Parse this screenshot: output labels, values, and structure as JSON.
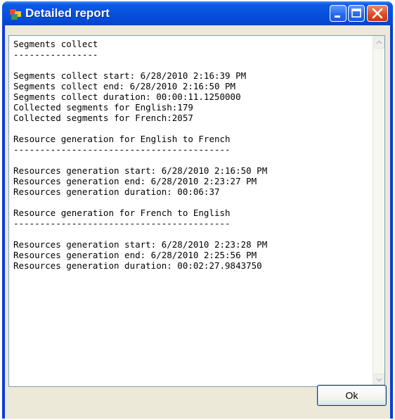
{
  "window": {
    "title": "Detailed report",
    "icons": {
      "app": "window-app-icon",
      "minimize": "minimize-icon",
      "maximize": "maximize-icon",
      "close": "close-icon"
    }
  },
  "report": {
    "lines": [
      "Segments collect",
      "----------------",
      "",
      "Segments collect start: 6/28/2010 2:16:39 PM",
      "Segments collect end: 6/28/2010 2:16:50 PM",
      "Segments collect duration: 00:00:11.1250000",
      "Collected segments for English:179",
      "Collected segments for French:2057",
      "",
      "Resource generation for English to French",
      "-----------------------------------------",
      "",
      "Resources generation start: 6/28/2010 2:16:50 PM",
      "Resources generation end: 6/28/2010 2:23:27 PM",
      "Resources generation duration: 00:06:37",
      "",
      "Resource generation for French to English",
      "-----------------------------------------",
      "",
      "Resources generation start: 6/28/2010 2:23:28 PM",
      "Resources generation end: 6/28/2010 2:25:56 PM",
      "Resources generation duration: 00:02:27.9843750"
    ]
  },
  "buttons": {
    "ok_label": "Ok"
  },
  "colors": {
    "titlebar": "#0753df",
    "client": "#ece9d8",
    "close": "#db4a22"
  }
}
